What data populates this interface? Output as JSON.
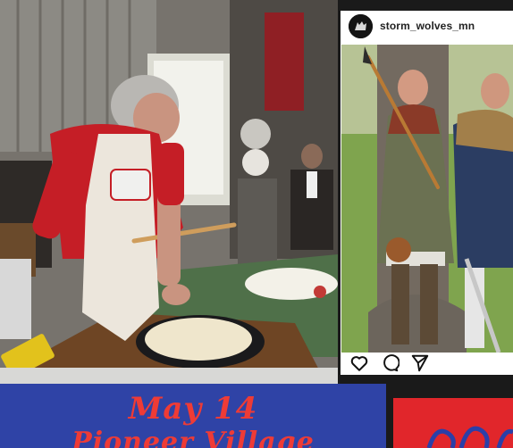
{
  "instagram": {
    "username": "storm_wolves_mn",
    "actions": [
      {
        "name": "like",
        "icon": "heart-icon"
      },
      {
        "name": "comment",
        "icon": "comment-icon"
      },
      {
        "name": "share",
        "icon": "send-icon"
      }
    ]
  },
  "banner": {
    "date": "May 14",
    "place": "Pioneer Village"
  },
  "colors": {
    "banner_blue": "#2f43a6",
    "banner_text_red": "#ee3b36",
    "accent_red": "#e1262b"
  }
}
